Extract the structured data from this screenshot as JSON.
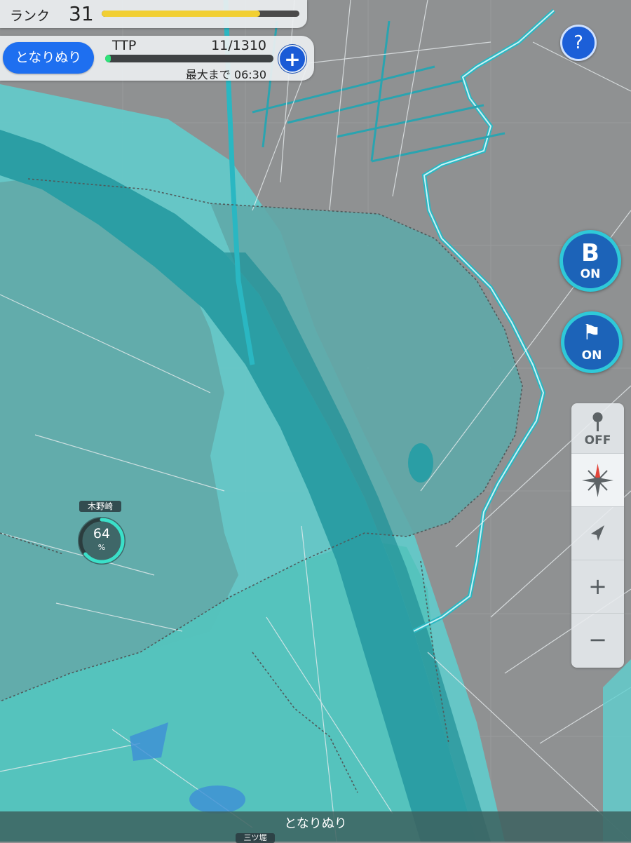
{
  "rank": {
    "label": "ランク",
    "value": "31",
    "progress": 0.8
  },
  "ttp": {
    "mode_button": "となりぬり",
    "label": "TTP",
    "count": "11/1310",
    "progress": 0.008,
    "timer": "最大まで 06:30",
    "add_icon": "plus-icon"
  },
  "help": {
    "icon": "?"
  },
  "toggles": {
    "b": {
      "glyph": "B",
      "state": "ON",
      "icon": "b-letter-icon"
    },
    "flag": {
      "glyph": "⚑",
      "state": "ON",
      "icon": "flag-pin-icon"
    }
  },
  "controls": {
    "pin_state": "OFF",
    "pin_icon": "pin-icon",
    "compass_icon": "compass-icon",
    "locate_icon": "navigation-arrow-icon",
    "zoom_in": "+",
    "zoom_out": "−"
  },
  "place": {
    "name": "木野崎",
    "percent": "64",
    "unit": "%",
    "progress": 0.64
  },
  "bottom": {
    "title": "となりぬり",
    "tag": "三ツ堀"
  },
  "colors": {
    "map_gray": "#8e9091",
    "river": "#2aa0a6",
    "painted": "#58c6c4",
    "accent_blue": "#1e6ff0",
    "ring_teal": "#2fc9d8"
  }
}
